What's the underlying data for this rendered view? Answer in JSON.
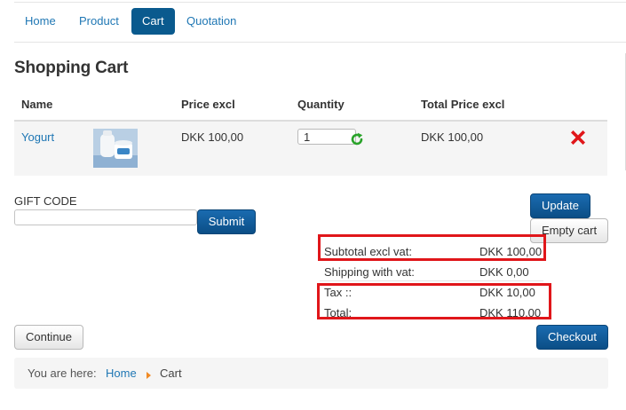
{
  "nav": {
    "tabs": [
      {
        "label": "Home"
      },
      {
        "label": "Product"
      },
      {
        "label": "Cart",
        "active": true
      },
      {
        "label": "Quotation"
      }
    ]
  },
  "page": {
    "title": "Shopping Cart"
  },
  "cart": {
    "columns": [
      "Name",
      "Price excl",
      "Quantity",
      "Total Price excl"
    ],
    "rows": [
      {
        "name": "Yogurt",
        "image": "yogurt-product-thumbnail",
        "price_excl": "DKK 100,00",
        "quantity": "1",
        "total_price_excl": "DKK 100,00"
      }
    ]
  },
  "gift": {
    "label": "GIFT CODE",
    "value": "",
    "submit_label": "Submit"
  },
  "actions": {
    "update_label": "Update",
    "empty_cart_label": "Empty cart",
    "continue_label": "Continue",
    "checkout_label": "Checkout"
  },
  "totals": {
    "subtotal": {
      "label": "Subtotal excl vat:",
      "value": "DKK 100,00"
    },
    "shipping": {
      "label": "Shipping with vat:",
      "value": "DKK 0,00"
    },
    "tax": {
      "label": "Tax ::",
      "value": "DKK 10,00"
    },
    "total": {
      "label": "Total:",
      "value": "DKK 110,00"
    }
  },
  "breadcrumb": {
    "prefix": "You are here:",
    "home": "Home",
    "current": "Cart"
  },
  "icons": {
    "refresh": "refresh-icon",
    "delete": "delete-icon",
    "breadcrumb_separator": "triangle-right-icon"
  },
  "colors": {
    "accent": "#0a5a8e",
    "link": "#1f77b4",
    "button": "#0e5a97",
    "highlight_box": "#e0161a",
    "refresh": "#2aa32a",
    "delete": "#e0161a",
    "breadcrumb_arrow": "#f08a24"
  }
}
